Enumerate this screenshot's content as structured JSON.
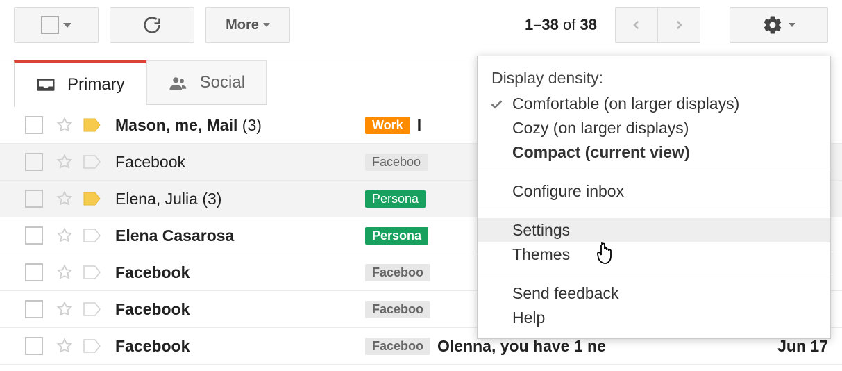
{
  "toolbar": {
    "more_label": "More",
    "pagination": {
      "range": "1–38",
      "of": "of",
      "total": "38"
    }
  },
  "tabs": [
    {
      "label": "Primary"
    },
    {
      "label": "Social"
    }
  ],
  "messages": [
    {
      "sender_bold": "Mason",
      "sender_rest": ", me, Mail",
      "count": "(3)",
      "label": "Work",
      "label_class": "work",
      "subject": "I",
      "date": "",
      "unread": true,
      "important": true
    },
    {
      "sender_bold": "",
      "sender_rest": "Facebook",
      "count": "",
      "label": "Faceboo",
      "label_class": "fb",
      "subject": "",
      "date": "",
      "unread": false,
      "important": false
    },
    {
      "sender_bold": "",
      "sender_rest": "Elena, Julia",
      "count": "(3)",
      "label": "Persona",
      "label_class": "personal",
      "subject": "",
      "date": "",
      "unread": false,
      "important": true
    },
    {
      "sender_bold": "Elena Casarosa",
      "sender_rest": "",
      "count": "",
      "label": "Persona",
      "label_class": "personal",
      "subject": "",
      "date": "",
      "unread": true,
      "important": false
    },
    {
      "sender_bold": "Facebook",
      "sender_rest": "",
      "count": "",
      "label": "Faceboo",
      "label_class": "fb",
      "subject": "",
      "date": "",
      "unread": true,
      "important": false
    },
    {
      "sender_bold": "Facebook",
      "sender_rest": "",
      "count": "",
      "label": "Faceboo",
      "label_class": "fb",
      "subject": "",
      "date": "",
      "unread": true,
      "important": false
    },
    {
      "sender_bold": "Facebook",
      "sender_rest": "",
      "count": "",
      "label": "Faceboo",
      "label_class": "fb",
      "subject": "Olenna, you have 1 ne",
      "date": "Jun 17",
      "unread": true,
      "important": false
    }
  ],
  "settings_menu": {
    "header": "Display density:",
    "options": {
      "comfortable": "Comfortable (on larger displays)",
      "cozy": "Cozy (on larger displays)",
      "compact": "Compact (current view)"
    },
    "configure": "Configure inbox",
    "settings": "Settings",
    "themes": "Themes",
    "feedback": "Send feedback",
    "help": "Help"
  }
}
